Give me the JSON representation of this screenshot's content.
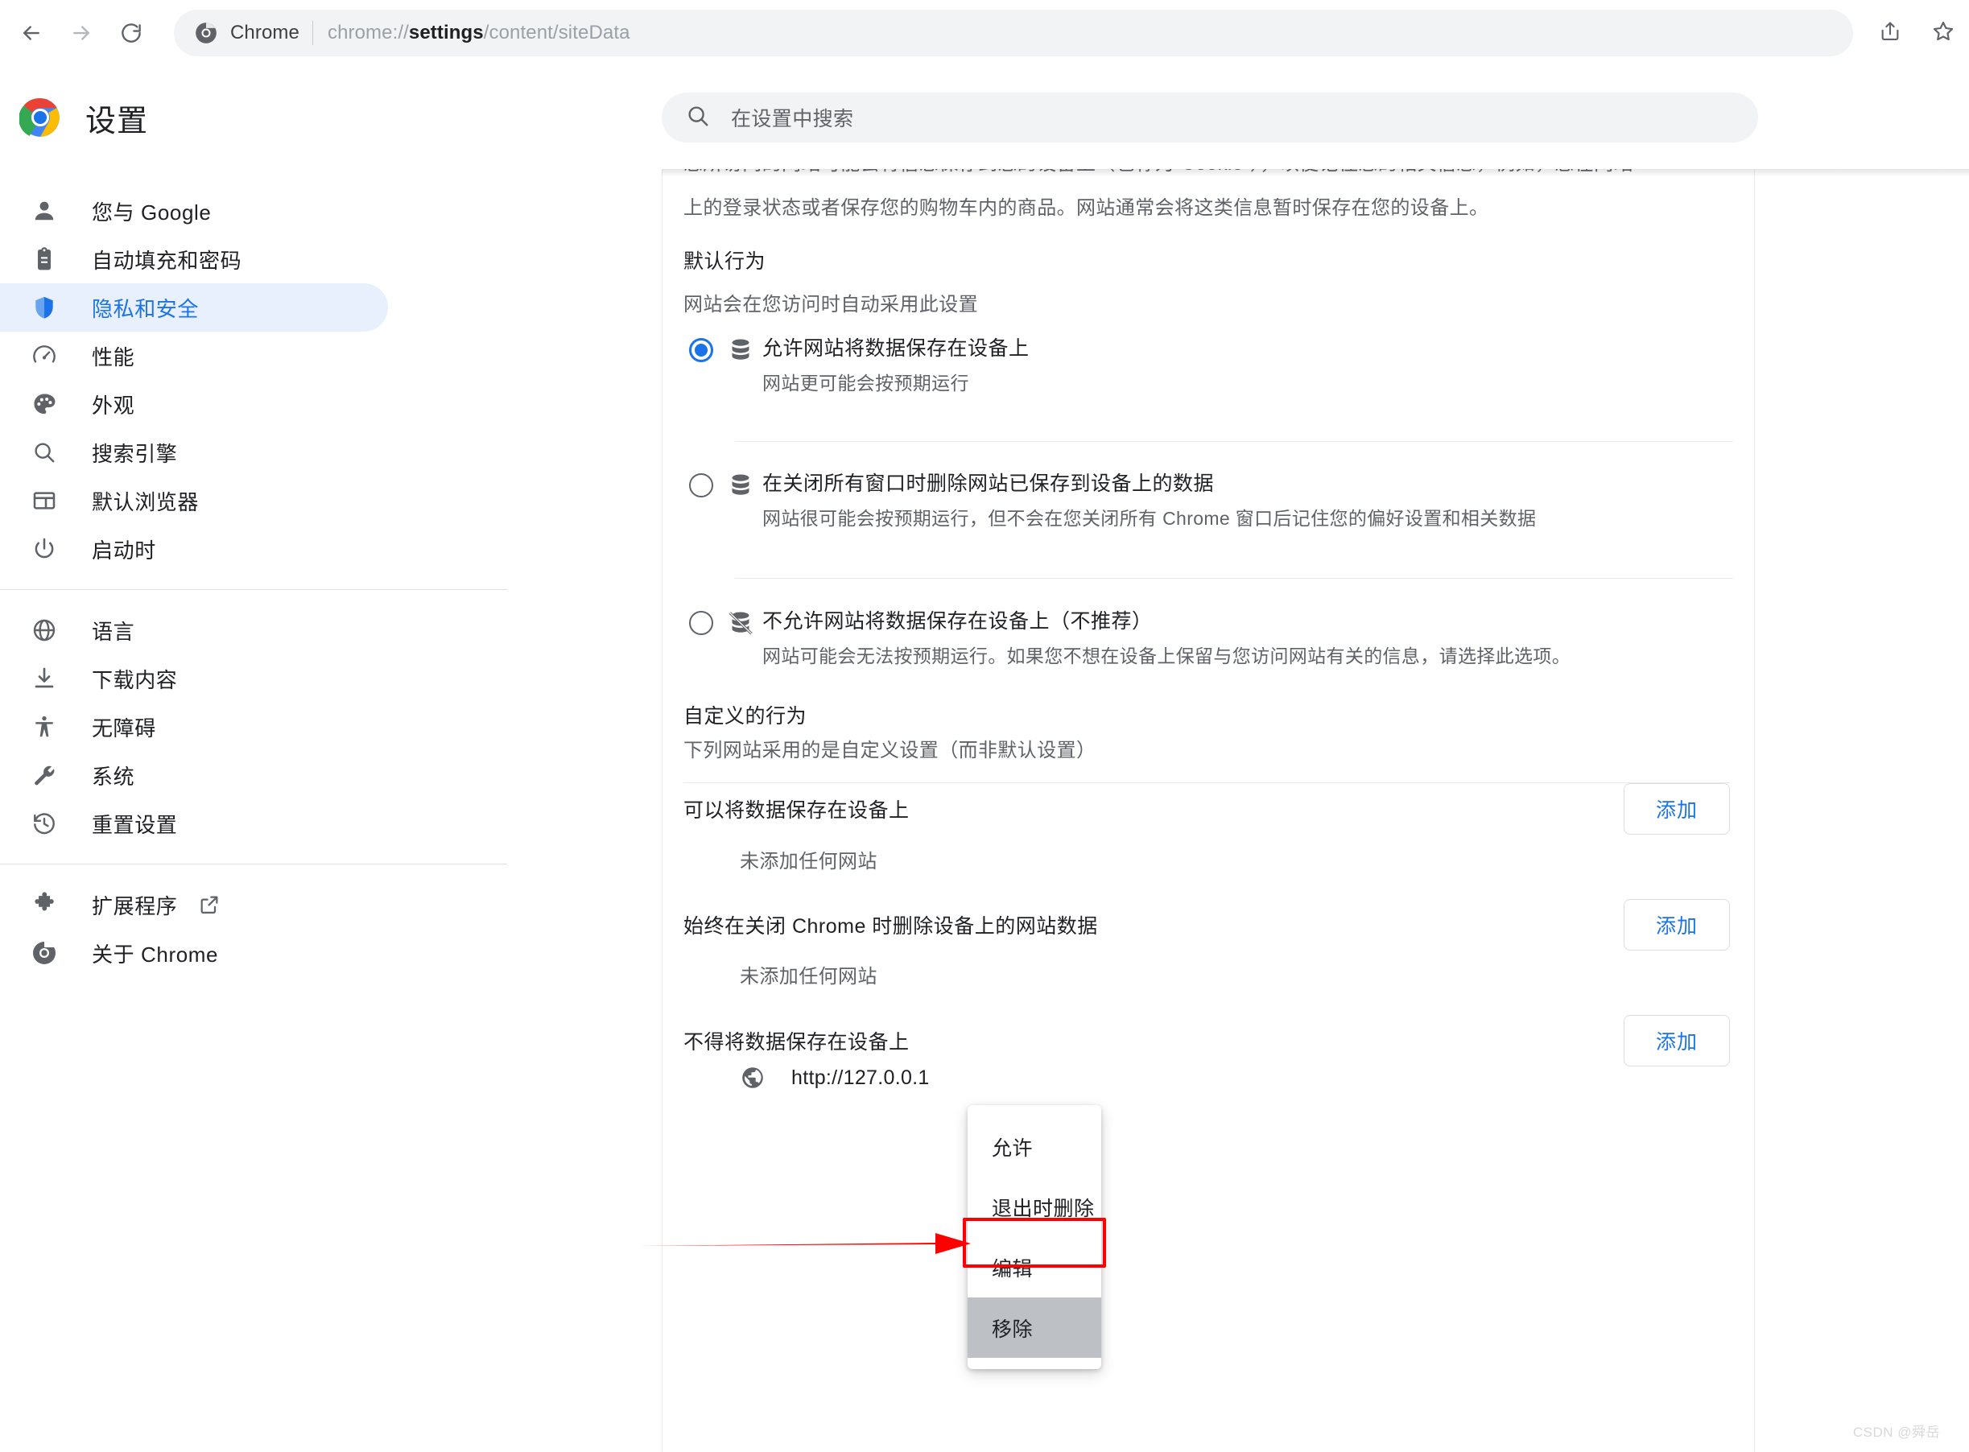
{
  "browser": {
    "back_icon": "arrow-left-icon",
    "forward_icon": "arrow-right-icon",
    "reload_icon": "reload-icon",
    "omnibox": {
      "chrome_icon": "chrome-logo-icon",
      "scheme_label": "Chrome",
      "url_prefix": "chrome://",
      "url_bold": "settings",
      "url_suffix": "/content/siteData",
      "full_url": "chrome://settings/content/siteData"
    },
    "share_icon": "share-icon",
    "bookmark_icon": "star-icon"
  },
  "settings_header": {
    "logo_icon": "chrome-logo-icon",
    "title": "设置",
    "search": {
      "icon": "search-icon",
      "placeholder": "在设置中搜索",
      "value": ""
    }
  },
  "sidebar": {
    "groups": [
      {
        "items": [
          {
            "icon": "person-icon",
            "label": "您与 Google",
            "active": false
          },
          {
            "icon": "clipboard-icon",
            "label": "自动填充和密码",
            "active": false
          },
          {
            "icon": "shield-icon",
            "label": "隐私和安全",
            "active": true
          },
          {
            "icon": "speed-icon",
            "label": "性能",
            "active": false
          },
          {
            "icon": "palette-icon",
            "label": "外观",
            "active": false
          },
          {
            "icon": "search-icon",
            "label": "搜索引擎",
            "active": false
          },
          {
            "icon": "browser-icon",
            "label": "默认浏览器",
            "active": false
          },
          {
            "icon": "power-icon",
            "label": "启动时",
            "active": false
          }
        ]
      },
      {
        "items": [
          {
            "icon": "globe-icon",
            "label": "语言",
            "active": false
          },
          {
            "icon": "download-icon",
            "label": "下载内容",
            "active": false
          },
          {
            "icon": "accessibility-icon",
            "label": "无障碍",
            "active": false
          },
          {
            "icon": "wrench-icon",
            "label": "系统",
            "active": false
          },
          {
            "icon": "history-icon",
            "label": "重置设置",
            "active": false
          }
        ]
      },
      {
        "items": [
          {
            "icon": "puzzle-icon",
            "label": "扩展程序",
            "active": false,
            "external_icon": "external-link-icon"
          },
          {
            "icon": "chrome-logo-icon",
            "label": "关于 Chrome",
            "active": false
          }
        ]
      }
    ]
  },
  "main": {
    "intro_clipped_line": "您所访问的网站可能会将信息保存到您的设备上（也称为“Cookie”），以便记住您的相关信息，例如，您在网站",
    "intro_line": "上的登录状态或者保存您的购物车内的商品。网站通常会将这类信息暂时保存在您的设备上。",
    "default_behavior": {
      "title": "默认行为",
      "subtitle": "网站会在您访问时自动采用此设置",
      "options": [
        {
          "icon": "database-icon",
          "label": "允许网站将数据保存在设备上",
          "desc": "网站更可能会按预期运行",
          "selected": true
        },
        {
          "icon": "database-icon",
          "label": "在关闭所有窗口时删除网站已保存到设备上的数据",
          "desc": "网站很可能会按预期运行，但不会在您关闭所有 Chrome 窗口后记住您的偏好设置和相关数据",
          "selected": false
        },
        {
          "icon": "database-off-icon",
          "label": "不允许网站将数据保存在设备上（不推荐）",
          "desc": "网站可能会无法按预期运行。如果您不想在设备上保留与您访问网站有关的信息，请选择此选项。",
          "selected": false
        }
      ]
    },
    "custom_behavior": {
      "title": "自定义的行为",
      "subtitle": "下列网站采用的是自定义设置（而非默认设置）",
      "groups": [
        {
          "label": "可以将数据保存在设备上",
          "add_label": "添加",
          "empty_text": "未添加任何网站",
          "sites": []
        },
        {
          "label": "始终在关闭 Chrome 时删除设备上的网站数据",
          "add_label": "添加",
          "empty_text": "未添加任何网站",
          "sites": []
        },
        {
          "label": "不得将数据保存在设备上",
          "add_label": "添加",
          "empty_text": "",
          "sites": [
            {
              "icon": "globe-icon",
              "url": "http://127.0.0.1"
            }
          ]
        }
      ]
    }
  },
  "context_menu": {
    "items": [
      {
        "label": "允许",
        "highlighted": false
      },
      {
        "label": "退出时删除",
        "highlighted": false
      },
      {
        "label": "编辑",
        "highlighted": false
      },
      {
        "label": "移除",
        "highlighted": true
      }
    ]
  },
  "annotation": {
    "color": "#ff0000",
    "arrow_icon": "arrow-right-annotation",
    "target_label": "移除"
  },
  "watermark": {
    "text": "CSDN @舜岳"
  },
  "colors": {
    "accent_blue": "#1a73e8",
    "active_nav_bg": "#e8f0fe",
    "text_primary": "#202124",
    "text_secondary": "#5f6368",
    "field_bg": "#f1f3f4",
    "annotation_red": "#ff0000",
    "menu_highlight": "#bdc1c6"
  }
}
